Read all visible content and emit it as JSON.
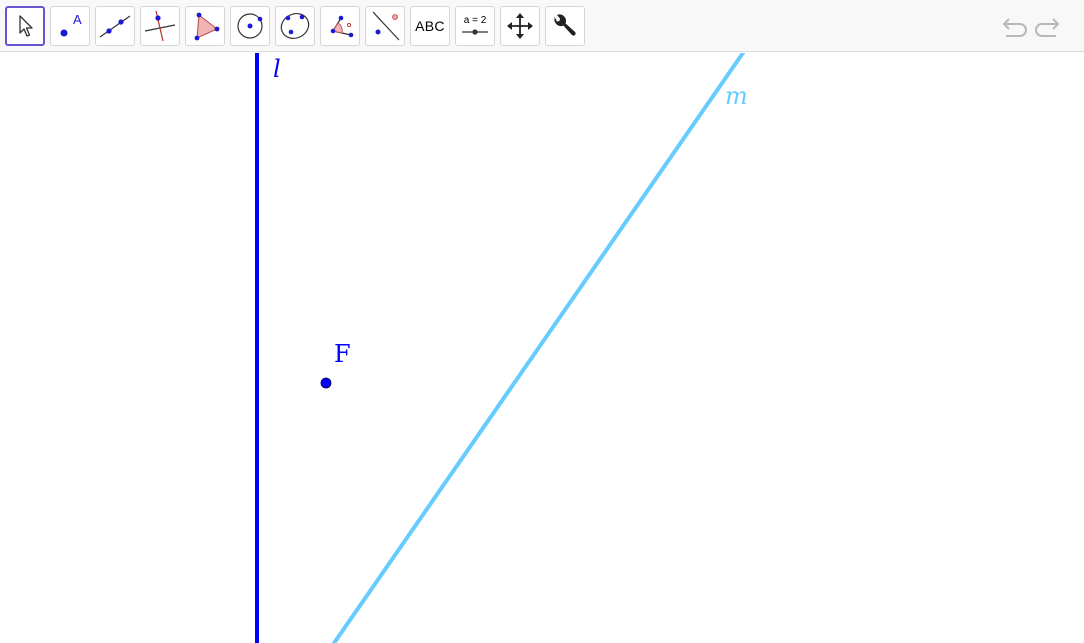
{
  "toolbar": {
    "tools": [
      {
        "name": "move-tool",
        "icon": "cursor-arrow-icon",
        "selected": true
      },
      {
        "name": "point-tool",
        "icon": "point-icon",
        "label": "A"
      },
      {
        "name": "line-tool",
        "icon": "line-through-two-points-icon"
      },
      {
        "name": "perpendicular-line-tool",
        "icon": "perpendicular-line-icon"
      },
      {
        "name": "polygon-tool",
        "icon": "polygon-icon"
      },
      {
        "name": "circle-center-point-tool",
        "icon": "circle-center-point-icon"
      },
      {
        "name": "conic-five-points-tool",
        "icon": "conic-icon"
      },
      {
        "name": "angle-tool",
        "icon": "angle-icon"
      },
      {
        "name": "reflect-about-line-tool",
        "icon": "reflect-icon"
      },
      {
        "name": "text-tool",
        "icon": "text-icon",
        "label": "ABC"
      },
      {
        "name": "slider-tool",
        "icon": "slider-icon",
        "label": "a = 2"
      },
      {
        "name": "move-graphics-view-tool",
        "icon": "move-arrows-icon"
      },
      {
        "name": "tools-tool",
        "icon": "wrench-icon"
      }
    ],
    "undo_icon": "undo-icon",
    "redo_icon": "redo-icon"
  },
  "canvas": {
    "objects": {
      "line_l": {
        "label": "l",
        "color": "#0000ff"
      },
      "line_m": {
        "label": "m",
        "color": "#66ccff"
      },
      "point_F": {
        "label": "F",
        "color": "#0000ff"
      }
    }
  }
}
